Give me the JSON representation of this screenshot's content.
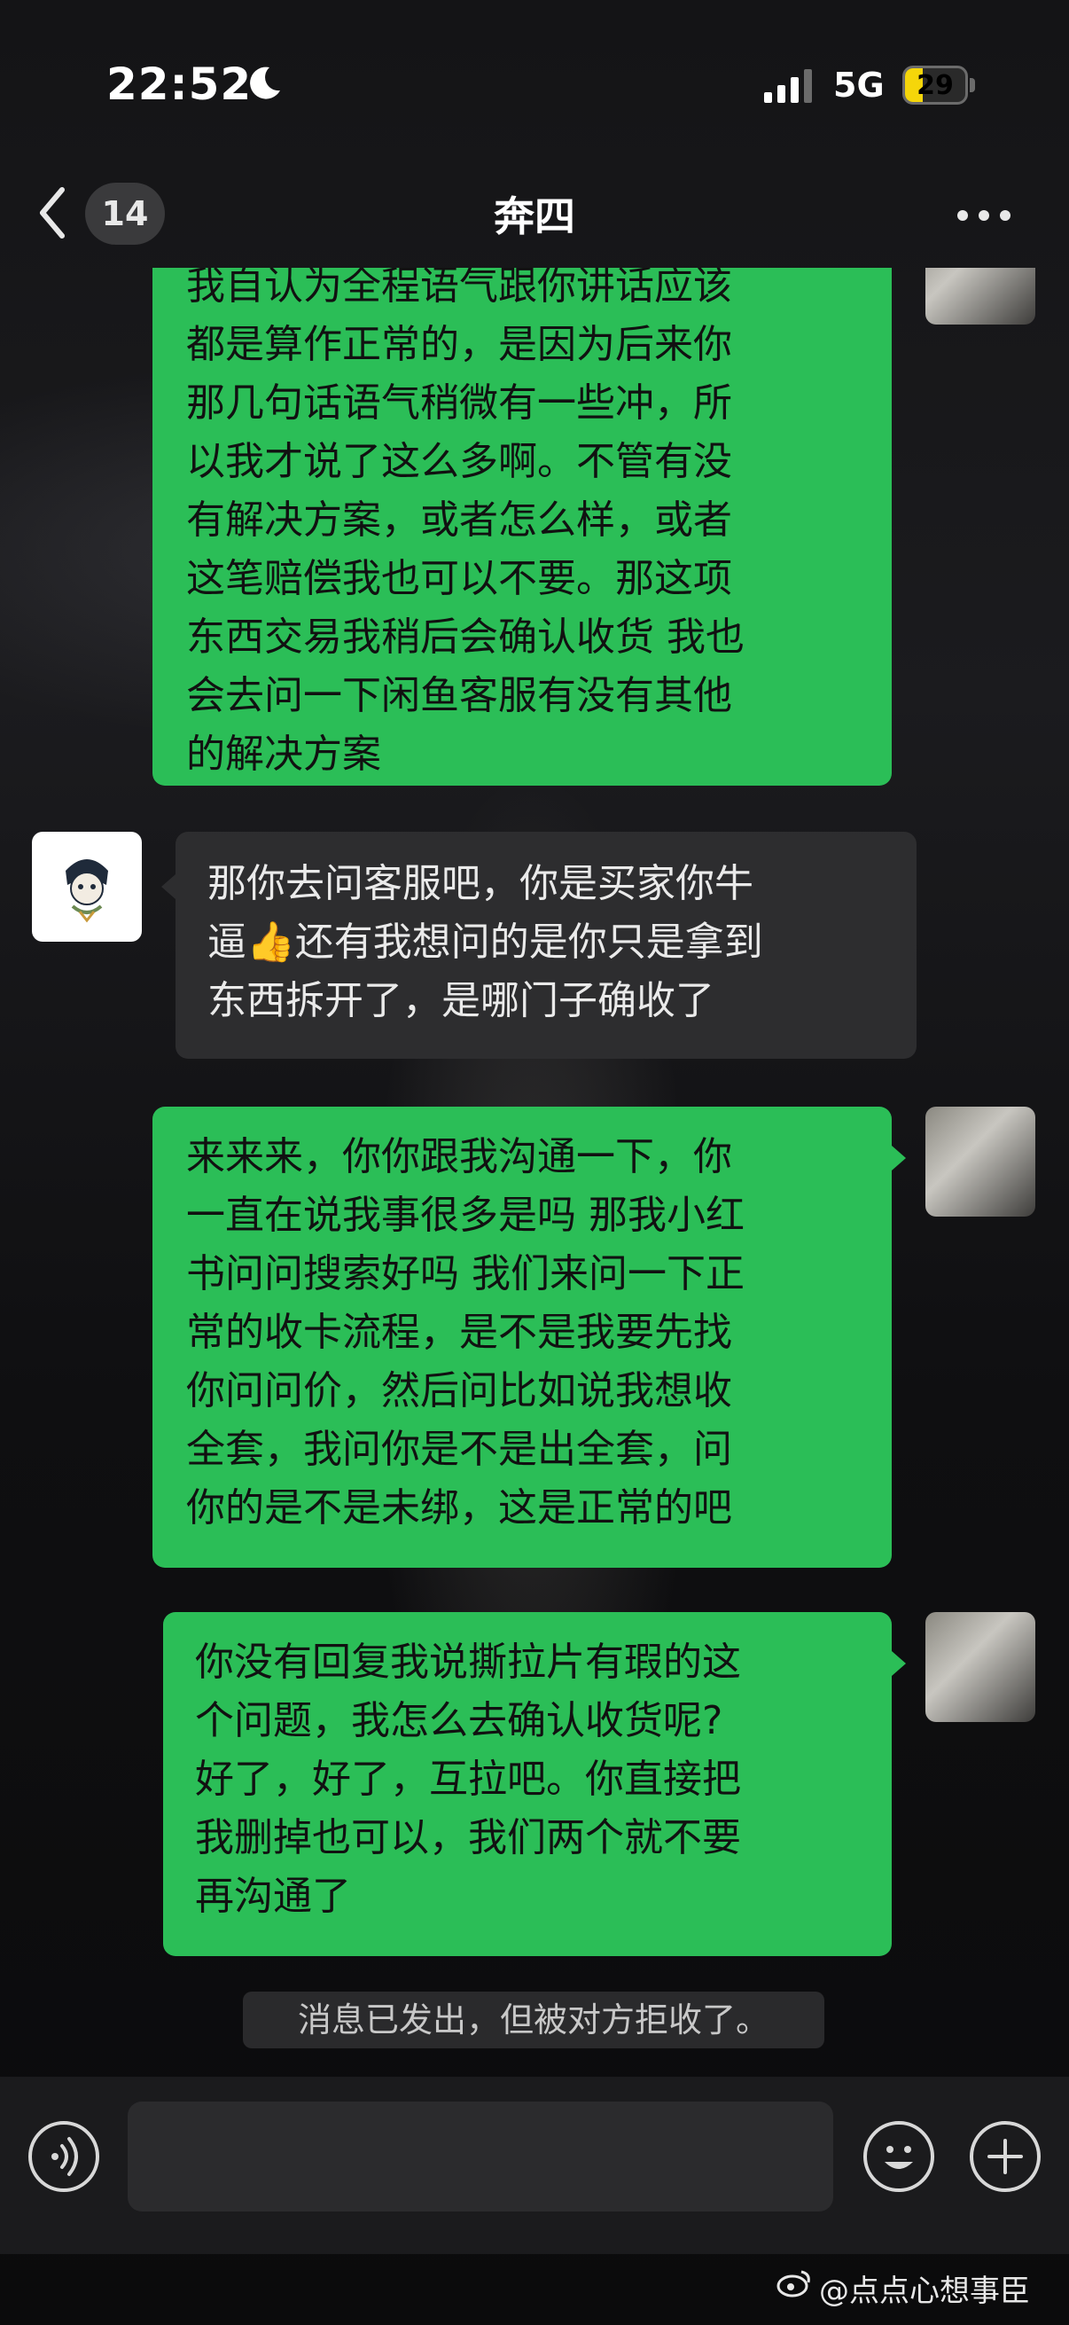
{
  "status_bar": {
    "time": "22:52",
    "network": "5G",
    "battery": "29",
    "battery_level_percent": 29
  },
  "header": {
    "back_count": "14",
    "contact_name": "奔四"
  },
  "messages": [
    {
      "direction": "out",
      "text": "我自认为全程语气跟你讲话应该\n都是算作正常的，是因为后来你\n那几句话语气稍微有一些冲，所\n以我才说了这么多啊。不管有没\n有解决方案，或者怎么样，或者\n这笔赔偿我也可以不要。那这项\n东西交易我稍后会确认收货 我也\n会去问一下闲鱼客服有没有其他\n的解决方案"
    },
    {
      "direction": "in",
      "text": "那你去问客服吧，你是买家你牛\n逼👍还有我想问的是你只是拿到\n东西拆开了，是哪门子确收了"
    },
    {
      "direction": "out",
      "text": "来来来，你你跟我沟通一下，你\n一直在说我事很多是吗 那我小红\n书问问搜索好吗 我们来问一下正\n常的收卡流程，是不是我要先找\n你问问价，然后问比如说我想收\n全套，我问你是不是出全套，问\n你的是不是未绑，这是正常的吧"
    },
    {
      "direction": "out",
      "text": "你没有回复我说撕拉片有瑕的这\n个问题，我怎么去确认收货呢?\n好了，好了，互拉吧。你直接把\n我删掉也可以，我们两个就不要\n再沟通了"
    }
  ],
  "system_notice": "消息已发出，但被对方拒收了。",
  "watermark": "@点点心想事臣",
  "colors": {
    "outgoing_bubble": "#2bbe57",
    "incoming_bubble": "#2d2d2f",
    "battery": "#f5d60a"
  }
}
